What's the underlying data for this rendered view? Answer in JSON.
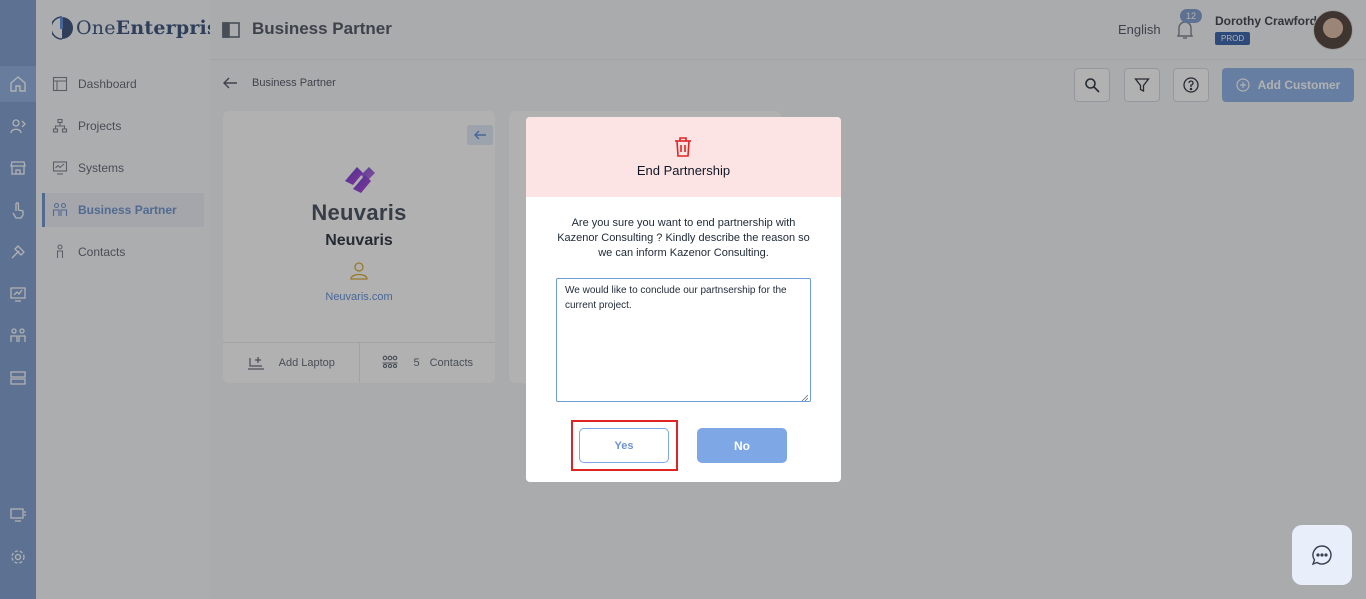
{
  "app": {
    "logo_prefix": "One",
    "logo_suffix": "Enterprise"
  },
  "sidebar": {
    "items": [
      {
        "label": "Dashboard",
        "icon": "dashboard-icon"
      },
      {
        "label": "Projects",
        "icon": "projects-icon"
      },
      {
        "label": "Systems",
        "icon": "systems-icon"
      },
      {
        "label": "Business Partner",
        "icon": "business-partner-icon",
        "active": true
      },
      {
        "label": "Contacts",
        "icon": "contacts-icon"
      }
    ]
  },
  "header": {
    "title": "Business Partner",
    "language": "English",
    "notification_count": "12",
    "user_name": "Dorothy Crawford",
    "environment": "PROD"
  },
  "breadcrumb": {
    "label": "Business Partner"
  },
  "toolbar": {
    "add_label": "Add Customer"
  },
  "card": {
    "brand_word": "Neuvaris",
    "name": "Neuvaris",
    "website": "Neuvaris.com",
    "footer_left": "Add Laptop",
    "contacts_count": "5",
    "contacts_label": "Contacts"
  },
  "modal": {
    "title": "End Partnership",
    "message": "Are you sure you want to end partnership with Kazenor Consulting ? Kindly describe the reason so we can inform Kazenor Consulting.",
    "reason_value": "We would like to conclude our partnsership for the current project.",
    "yes_label": "Yes",
    "no_label": "No"
  },
  "colors": {
    "accent": "#6e93cc",
    "danger": "#e02424",
    "modal_header": "#fde4e4"
  }
}
